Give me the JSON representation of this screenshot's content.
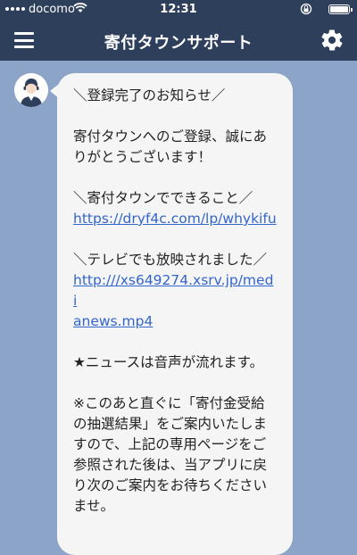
{
  "status_bar": {
    "carrier": "docomo",
    "time": "12:31"
  },
  "header": {
    "title": "寄付タウンサポート",
    "menu_icon": "hamburger-menu-icon",
    "settings_icon": "gear-icon"
  },
  "chat": {
    "message": {
      "heading": "＼登録完了のお知らせ／",
      "thanks_1": "寄付タウンへのご登録、誠にあ",
      "thanks_2": "りがとうございます！",
      "feature_heading": "＼寄付タウンでできること／",
      "feature_link": "https://dryf4c.com/lp/whykifu",
      "tv_heading": "＼テレビでも放映されました／",
      "tv_link_1": "http:///xs649274.xsrv.jp/medi",
      "tv_link_2": "anews.mp4",
      "audio_note": "★ニュースは音声が流れます。",
      "note_1": "※このあと直ぐに「寄付金受給",
      "note_2": "の抽選結果」をご案内いたしま",
      "note_3": "すので、上記の専用ページをご",
      "note_4": "参照された後は、当アプリに戻",
      "note_5": "り次のご案内をお待ちください",
      "note_6": "ませ。"
    }
  },
  "colors": {
    "header_bg": "#2e3f5c",
    "chat_bg": "#8da4c9",
    "bubble_bg": "#f5f5f5",
    "link": "#3366cc"
  }
}
